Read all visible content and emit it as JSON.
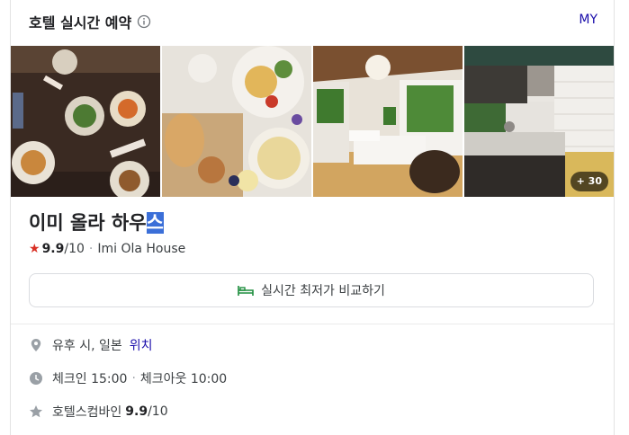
{
  "header": {
    "title": "호텔 실시간 예약",
    "my_label": "MY"
  },
  "gallery": {
    "more_count": "+ 30"
  },
  "hotel": {
    "name_main": "이미 올라 하우",
    "name_highlight": "스",
    "rating_score": "9.9",
    "rating_max": "/10",
    "dot": "·",
    "english_name": "Imi Ola House"
  },
  "compare": {
    "label": "실시간 최저가 비교하기"
  },
  "location": {
    "text": "유후 시, 일본",
    "link": "위치"
  },
  "checkin": {
    "checkin": "체크인 15:00",
    "dot": "·",
    "checkout": "체크아웃 10:00"
  },
  "review": {
    "source": "호텔스컴바인",
    "score": "9.9",
    "max": "/10"
  },
  "colors": {
    "link": "#1a0dab",
    "star": "#d93025",
    "bed_icon": "#1e8e3e",
    "highlight": "#3b6fd8"
  }
}
